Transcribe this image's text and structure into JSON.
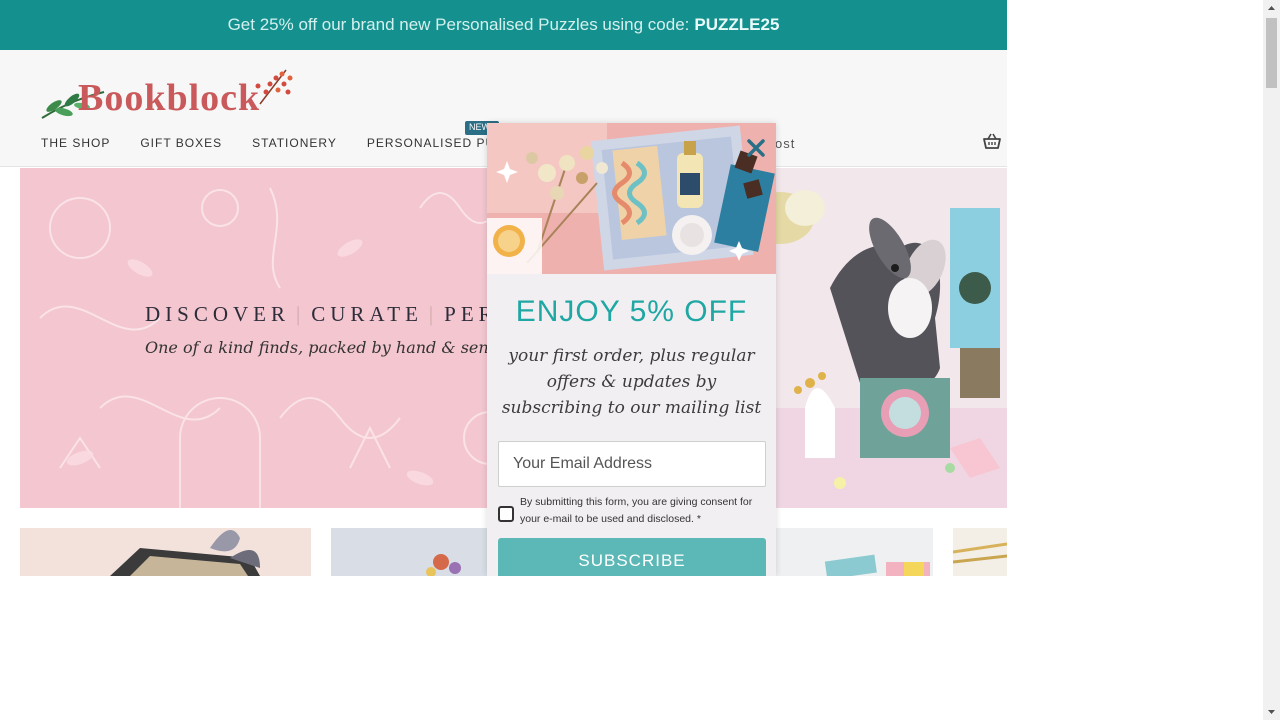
{
  "promo": {
    "text": "Get 25% off our brand new Personalised Puzzles using code:",
    "code": "PUZZLE25"
  },
  "header": {
    "logo_text": "Bookblock",
    "nav": [
      {
        "label": "THE SHOP"
      },
      {
        "label": "GIFT BOXES"
      },
      {
        "label": "STATIONERY"
      },
      {
        "label": "PERSONALISED PUZZLES"
      }
    ],
    "new_badge": "NEW",
    "blog_fragment": "ost",
    "basket_icon": "basket-icon"
  },
  "hero": {
    "title_words": [
      "DISCOVER",
      "CURATE",
      "PERS"
    ],
    "subtitle": "One of a kind finds, packed by hand & sent t"
  },
  "modal": {
    "heading": "ENJOY 5% OFF",
    "text": "your first order, plus regular offers & updates by subscribing to our mailing list",
    "email_placeholder": "Your Email Address",
    "consent_text": "By submitting this form, you are giving consent for your e-mail to be used and disclosed. *",
    "subscribe_label": "SUBSCRIBE",
    "close_icon": "close-icon"
  },
  "colors": {
    "promo_bg": "#14918e",
    "accent_teal": "#1fa7a3",
    "button_teal": "#5bb8b6",
    "hero_pink": "#f3c6d0"
  }
}
